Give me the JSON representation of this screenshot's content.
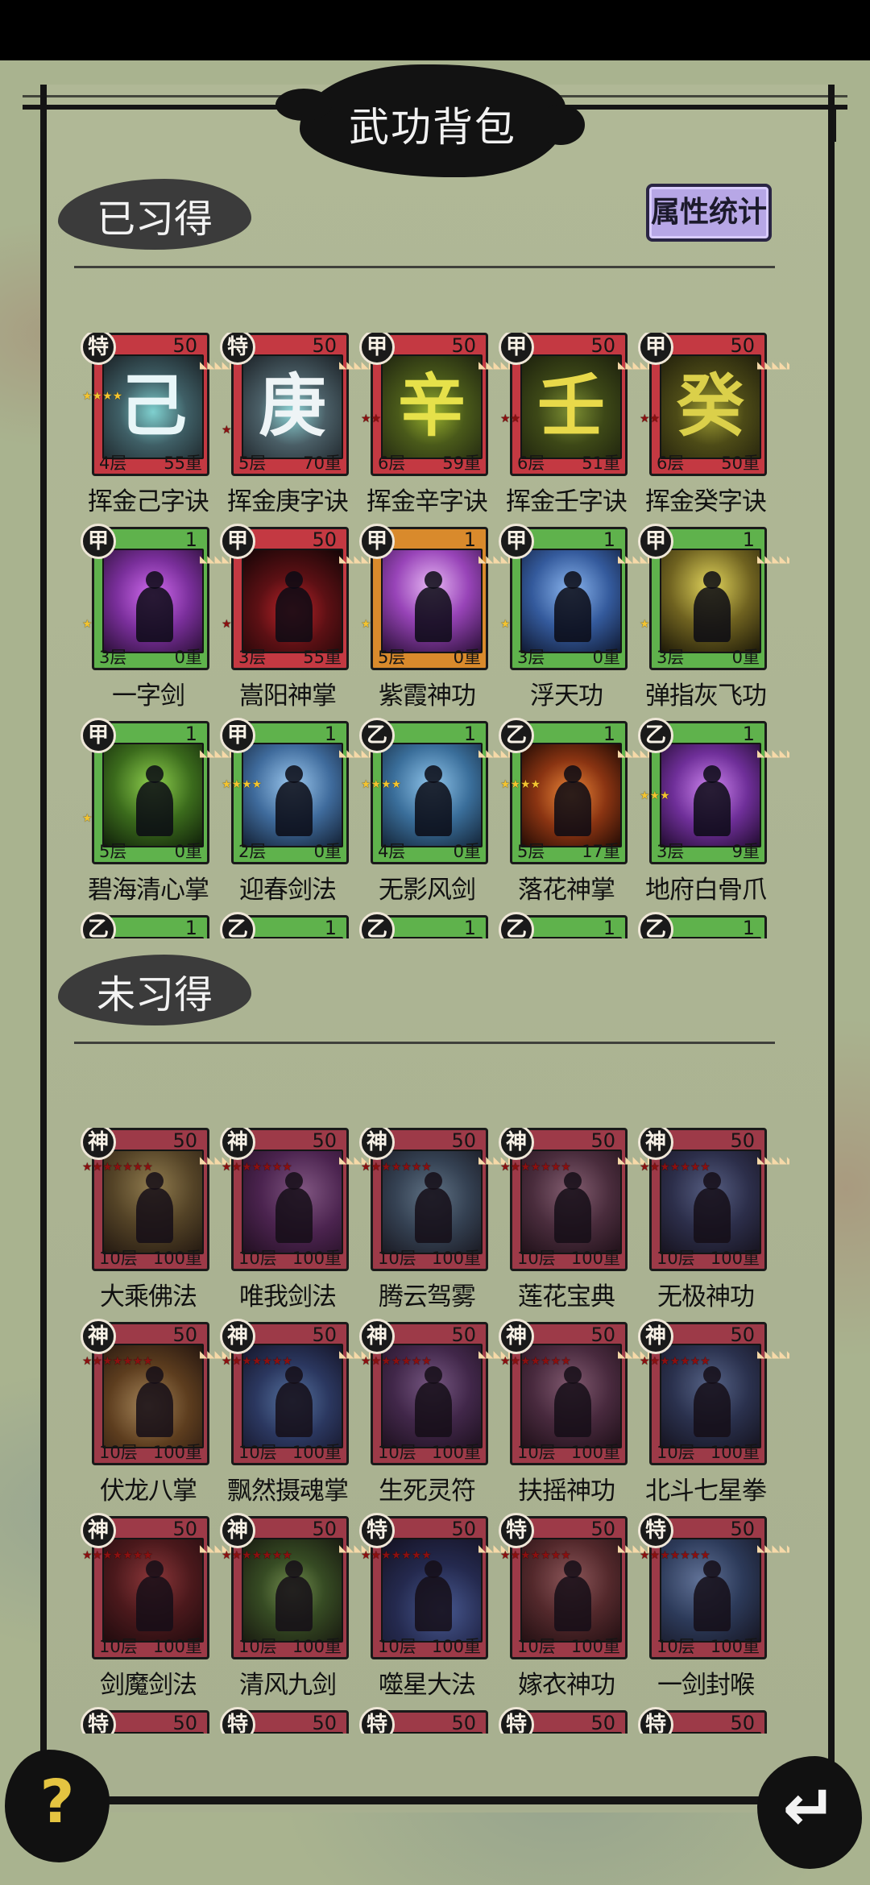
{
  "title": "武功背包",
  "learned_section": {
    "label": "已习得"
  },
  "stats_button": {
    "label": "属性统计"
  },
  "unlearned_section": {
    "label": "未习得"
  },
  "learned_skills": [
    {
      "name": "挥金己字诀",
      "grade": "特",
      "level": "50",
      "layers": "4层",
      "weight": "55重",
      "frame": "red",
      "stars": 4,
      "star_color": "gold",
      "glyph": "己",
      "glyph_color": "#e8f6f8",
      "art_bg": "radial-gradient(circle at 50% 55%, #7fd0cf 0%, #3f5f66 45%, #1b2226 100%)"
    },
    {
      "name": "挥金庚字诀",
      "grade": "特",
      "level": "50",
      "layers": "5层",
      "weight": "70重",
      "frame": "red",
      "stars": 1,
      "star_color": "red",
      "glyph": "庚",
      "glyph_color": "#eef4f6",
      "art_bg": "radial-gradient(circle at 50% 55%, #8fd6d8 0%, #4a5e66 45%, #1c2227 100%)"
    },
    {
      "name": "挥金辛字诀",
      "grade": "甲",
      "level": "50",
      "layers": "6层",
      "weight": "59重",
      "frame": "red",
      "stars": 2,
      "star_color": "red",
      "glyph": "辛",
      "glyph_color": "#e6e14a",
      "art_bg": "radial-gradient(circle at 50% 55%, #9bb32e 0%, #4a5a1a 45%, #1f2410 100%)"
    },
    {
      "name": "挥金壬字诀",
      "grade": "甲",
      "level": "50",
      "layers": "6层",
      "weight": "51重",
      "frame": "red",
      "stars": 2,
      "star_color": "red",
      "glyph": "壬",
      "glyph_color": "#e8d94a",
      "art_bg": "radial-gradient(circle at 50% 55%, #7c8e32 0%, #3d4817 45%, #1c200d 100%)"
    },
    {
      "name": "挥金癸字诀",
      "grade": "甲",
      "level": "50",
      "layers": "6层",
      "weight": "50重",
      "frame": "red",
      "stars": 2,
      "star_color": "red",
      "glyph": "癸",
      "glyph_color": "#dbd04a",
      "art_bg": "radial-gradient(circle at 50% 55%, #a3a134 0%, #4d4b17 45%, #22200c 100%)"
    },
    {
      "name": "一字剑",
      "grade": "甲",
      "level": "1",
      "layers": "3层",
      "weight": "0重",
      "frame": "green",
      "stars": 1,
      "star_color": "gold",
      "glyph": "",
      "glyph_color": "#ffffff",
      "art_bg": "radial-gradient(circle at 50% 45%, #d26cf0 0%, #7a2f9b 50%, #2c1038 100%)"
    },
    {
      "name": "嵩阳神掌",
      "grade": "甲",
      "level": "50",
      "layers": "3层",
      "weight": "55重",
      "frame": "red",
      "stars": 1,
      "star_color": "red",
      "glyph": "",
      "glyph_color": "#ffffff",
      "art_bg": "radial-gradient(circle at 50% 60%, #c0242a 0%, #5c1014 45%, #140506 100%)"
    },
    {
      "name": "紫霞神功",
      "grade": "甲",
      "level": "1",
      "layers": "5层",
      "weight": "0重",
      "frame": "orange",
      "stars": 1,
      "star_color": "gold",
      "glyph": "",
      "glyph_color": "#ffffff",
      "art_bg": "radial-gradient(circle at 50% 35%, #e7b7f4 0%, #9844b8 45%, #2b1038 100%)"
    },
    {
      "name": "浮天功",
      "grade": "甲",
      "level": "1",
      "layers": "3层",
      "weight": "0重",
      "frame": "green",
      "stars": 1,
      "star_color": "gold",
      "glyph": "",
      "glyph_color": "#ffffff",
      "art_bg": "radial-gradient(circle at 50% 40%, #8bb6ef 0%, #345a9c 50%, #101a33 100%)"
    },
    {
      "name": "弹指灰飞功",
      "grade": "甲",
      "level": "1",
      "layers": "3层",
      "weight": "0重",
      "frame": "green",
      "stars": 1,
      "star_color": "gold",
      "glyph": "",
      "glyph_color": "#ffffff",
      "art_bg": "radial-gradient(circle at 50% 35%, #e1d45b 0%, #6f6220 50%, #1e1a08 100%)"
    },
    {
      "name": "碧海清心掌",
      "grade": "甲",
      "level": "1",
      "layers": "5层",
      "weight": "0重",
      "frame": "green",
      "stars": 1,
      "star_color": "gold",
      "glyph": "",
      "glyph_color": "#ffffff",
      "art_bg": "radial-gradient(circle at 50% 40%, #8fd04e 0%, #3b6b1c 50%, #10200a 100%)"
    },
    {
      "name": "迎春剑法",
      "grade": "甲",
      "level": "1",
      "layers": "2层",
      "weight": "0重",
      "frame": "green",
      "stars": 4,
      "star_color": "gold",
      "glyph": "",
      "glyph_color": "#ffffff",
      "art_bg": "radial-gradient(circle at 50% 40%, #9cc8ee 0%, #3f6b9c 50%, #132033 100%)"
    },
    {
      "name": "无影风剑",
      "grade": "乙",
      "level": "1",
      "layers": "4层",
      "weight": "0重",
      "frame": "green",
      "stars": 4,
      "star_color": "gold",
      "glyph": "",
      "glyph_color": "#ffffff",
      "art_bg": "radial-gradient(circle at 50% 40%, #8fc4ea 0%, #3a6e9a 50%, #142538 100%)"
    },
    {
      "name": "落花神掌",
      "grade": "乙",
      "level": "1",
      "layers": "5层",
      "weight": "17重",
      "frame": "green",
      "stars": 4,
      "star_color": "gold",
      "glyph": "",
      "glyph_color": "#ffffff",
      "art_bg": "radial-gradient(circle at 50% 50%, #f08a3a 0%, #8a3412 50%, #240c05 100%)"
    },
    {
      "name": "地府白骨爪",
      "grade": "乙",
      "level": "1",
      "layers": "3层",
      "weight": "9重",
      "frame": "green",
      "stars": 3,
      "star_color": "gold",
      "glyph": "",
      "glyph_color": "#ffffff",
      "art_bg": "radial-gradient(circle at 50% 45%, #cf86f0 0%, #6f2f99 50%, #220c30 100%)"
    },
    {
      "name": "",
      "grade": "乙",
      "level": "1",
      "layers": "",
      "weight": "",
      "frame": "green",
      "stars": 0,
      "star_color": "gold",
      "glyph": "",
      "glyph_color": "#ffffff",
      "art_bg": "#6e7a2a"
    },
    {
      "name": "",
      "grade": "乙",
      "level": "1",
      "layers": "",
      "weight": "",
      "frame": "green",
      "stars": 0,
      "star_color": "gold",
      "glyph": "",
      "glyph_color": "#ffffff",
      "art_bg": "#6e7a2a"
    },
    {
      "name": "",
      "grade": "乙",
      "level": "1",
      "layers": "",
      "weight": "",
      "frame": "green",
      "stars": 0,
      "star_color": "gold",
      "glyph": "",
      "glyph_color": "#ffffff",
      "art_bg": "#6e7a2a"
    },
    {
      "name": "",
      "grade": "乙",
      "level": "1",
      "layers": "",
      "weight": "",
      "frame": "green",
      "stars": 0,
      "star_color": "gold",
      "glyph": "",
      "glyph_color": "#ffffff",
      "art_bg": "#6e7a2a"
    },
    {
      "name": "",
      "grade": "乙",
      "level": "1",
      "layers": "",
      "weight": "",
      "frame": "green",
      "stars": 0,
      "star_color": "gold",
      "glyph": "",
      "glyph_color": "#ffffff",
      "art_bg": "#6e7a2a"
    }
  ],
  "unlearned_skills": [
    {
      "name": "大乘佛法",
      "grade": "神",
      "level": "50",
      "layers": "10层",
      "weight": "100重",
      "art_bg": "radial-gradient(circle at 50% 35%, #c9b46a 0%, #6b5c2c 50%, #231d0c 100%)"
    },
    {
      "name": "唯我剑法",
      "grade": "神",
      "level": "50",
      "layers": "10层",
      "weight": "100重",
      "art_bg": "radial-gradient(circle at 60% 40%, #b07ab8 0%, #5e2c6a 50%, #1f0d24 100%)"
    },
    {
      "name": "腾云驾雾",
      "grade": "神",
      "level": "50",
      "layers": "10层",
      "weight": "100重",
      "art_bg": "radial-gradient(circle at 50% 45%, #7fa6be 0%, #3c5a70 50%, #141f28 100%)"
    },
    {
      "name": "莲花宝典",
      "grade": "神",
      "level": "50",
      "layers": "10层",
      "weight": "100重",
      "art_bg": "radial-gradient(circle at 50% 40%, #b5869e 0%, #5c3a4e 50%, #1e1119 100%)"
    },
    {
      "name": "无极神功",
      "grade": "神",
      "level": "50",
      "layers": "10层",
      "weight": "100重",
      "art_bg": "radial-gradient(circle at 50% 40%, #6f86b8 0%, #2f3d63 50%, #0f1422 100%)"
    },
    {
      "name": "伏龙八掌",
      "grade": "神",
      "level": "50",
      "layers": "10层",
      "weight": "100重",
      "art_bg": "radial-gradient(circle at 45% 60%, #e8c27a 0%, #7a5420 50%, #24180a 100%)"
    },
    {
      "name": "飘然摄魂掌",
      "grade": "神",
      "level": "50",
      "layers": "10层",
      "weight": "100重",
      "art_bg": "radial-gradient(circle at 50% 55%, #6fa6e6 0%, #2d4b84 50%, #0d1730 100%)"
    },
    {
      "name": "生死灵符",
      "grade": "神",
      "level": "50",
      "layers": "10层",
      "weight": "100重",
      "art_bg": "radial-gradient(circle at 50% 40%, #a07bb8 0%, #4f3262 50%, #1a1022 100%)"
    },
    {
      "name": "扶摇神功",
      "grade": "神",
      "level": "50",
      "layers": "10层",
      "weight": "100重",
      "art_bg": "radial-gradient(circle at 50% 40%, #b07f9c 0%, #5a3650 50%, #1c0f18 100%)"
    },
    {
      "name": "北斗七星拳",
      "grade": "神",
      "level": "50",
      "layers": "10层",
      "weight": "100重",
      "art_bg": "radial-gradient(circle at 50% 40%, #6f8ec0 0%, #2c4168 50%, #0d1524 100%)"
    },
    {
      "name": "剑魔剑法",
      "grade": "神",
      "level": "50",
      "layers": "10层",
      "weight": "100重",
      "art_bg": "radial-gradient(circle at 50% 40%, #c24a4a 0%, #5e1c1c 50%, #1d0707 100%)"
    },
    {
      "name": "清风九剑",
      "grade": "神",
      "level": "50",
      "layers": "10层",
      "weight": "100重",
      "art_bg": "radial-gradient(circle at 50% 50%, #9ccf6a 0%, #3f6a28 45%, #12200b 100%)"
    },
    {
      "name": "噬星大法",
      "grade": "特",
      "level": "50",
      "layers": "10层",
      "weight": "100重",
      "art_bg": "radial-gradient(circle at 60% 70%, #5a7fd0 0%, #23366a 50%, #0a1024 100%)"
    },
    {
      "name": "嫁衣神功",
      "grade": "特",
      "level": "50",
      "layers": "10层",
      "weight": "100重",
      "art_bg": "radial-gradient(circle at 50% 40%, #c27a7a 0%, #6a3434 50%, #220f0f 100%)"
    },
    {
      "name": "一剑封喉",
      "grade": "特",
      "level": "50",
      "layers": "10层",
      "weight": "100重",
      "art_bg": "radial-gradient(circle at 40% 40%, #7fa4d8 0%, #2f4f7a 50%, #0e1828 100%)"
    },
    {
      "name": "",
      "grade": "特",
      "level": "50",
      "layers": "",
      "weight": "",
      "art_bg": "#5a2a3a"
    },
    {
      "name": "",
      "grade": "特",
      "level": "50",
      "layers": "",
      "weight": "",
      "art_bg": "#5a2a3a"
    },
    {
      "name": "",
      "grade": "特",
      "level": "50",
      "layers": "",
      "weight": "",
      "art_bg": "#5a2a3a"
    },
    {
      "name": "",
      "grade": "特",
      "level": "50",
      "layers": "",
      "weight": "",
      "art_bg": "#5a2a3a"
    },
    {
      "name": "",
      "grade": "特",
      "level": "50",
      "layers": "",
      "weight": "",
      "art_bg": "#5a2a3a"
    }
  ],
  "help_button": {
    "label": "?",
    "icon": "question-mark-icon"
  },
  "back_button": {
    "label": "↵",
    "icon": "return-arrow-icon"
  },
  "colors": {
    "frame_red": "#c43942",
    "frame_green": "#5fb24c",
    "frame_orange": "#d98a2c",
    "stats_button_bg": "#b7a7e6",
    "background": "#a9b38f"
  }
}
